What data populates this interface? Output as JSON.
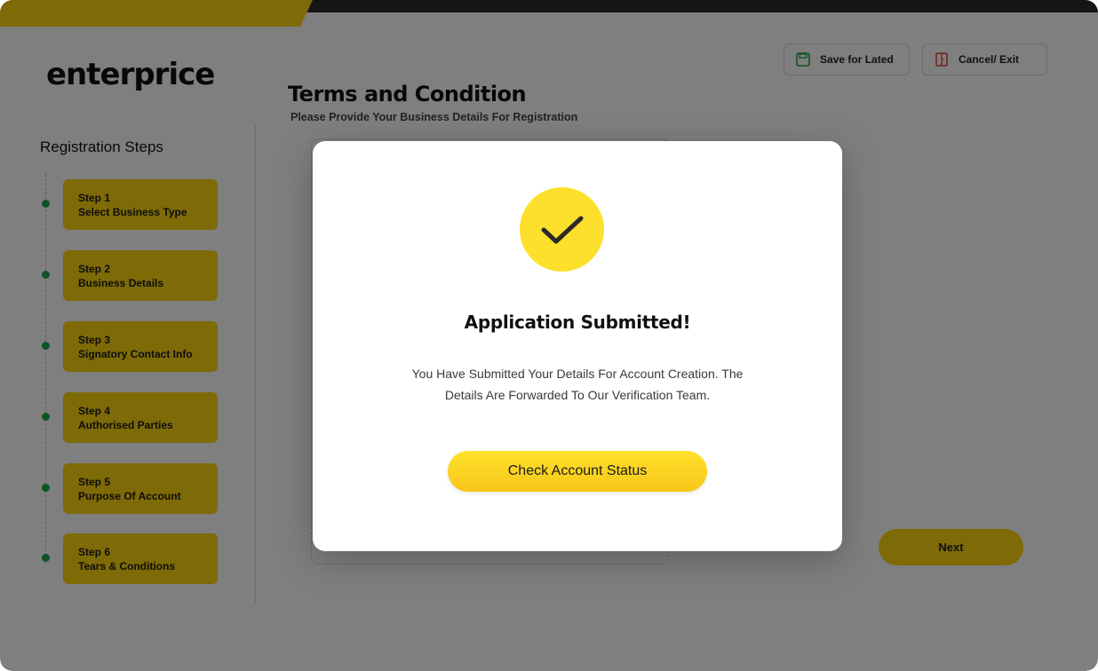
{
  "brand": {
    "logo_text": "enterprice"
  },
  "header": {
    "save_label": "Save for Lated",
    "cancel_label": "Cancel/ Exit",
    "title": "Terms and Condition",
    "subtitle": "Please Provide Your Business Details For Registration"
  },
  "sidebar": {
    "title": "Registration Steps",
    "steps": [
      {
        "num": "Step 1",
        "label": "Select Business Type"
      },
      {
        "num": "Step 2",
        "label": "Business Details"
      },
      {
        "num": "Step 3",
        "label": "Signatory Contact Info"
      },
      {
        "num": "Step 4",
        "label": "Authorised Parties"
      },
      {
        "num": "Step 5",
        "label": "Purpose Of Account"
      },
      {
        "num": "Step 6",
        "label": "Tears & Conditions"
      }
    ]
  },
  "footer": {
    "next_label": "Next"
  },
  "modal": {
    "title": "Application Submitted!",
    "body": "You Have Submitted Your Details For Account Creation. The Details Are Forwarded To Our Verification Team.",
    "button_label": "Check Account Status"
  },
  "colors": {
    "accent": "#fcd40f",
    "step_dot": "#1fa64a",
    "dark": "#2b2b2b"
  }
}
